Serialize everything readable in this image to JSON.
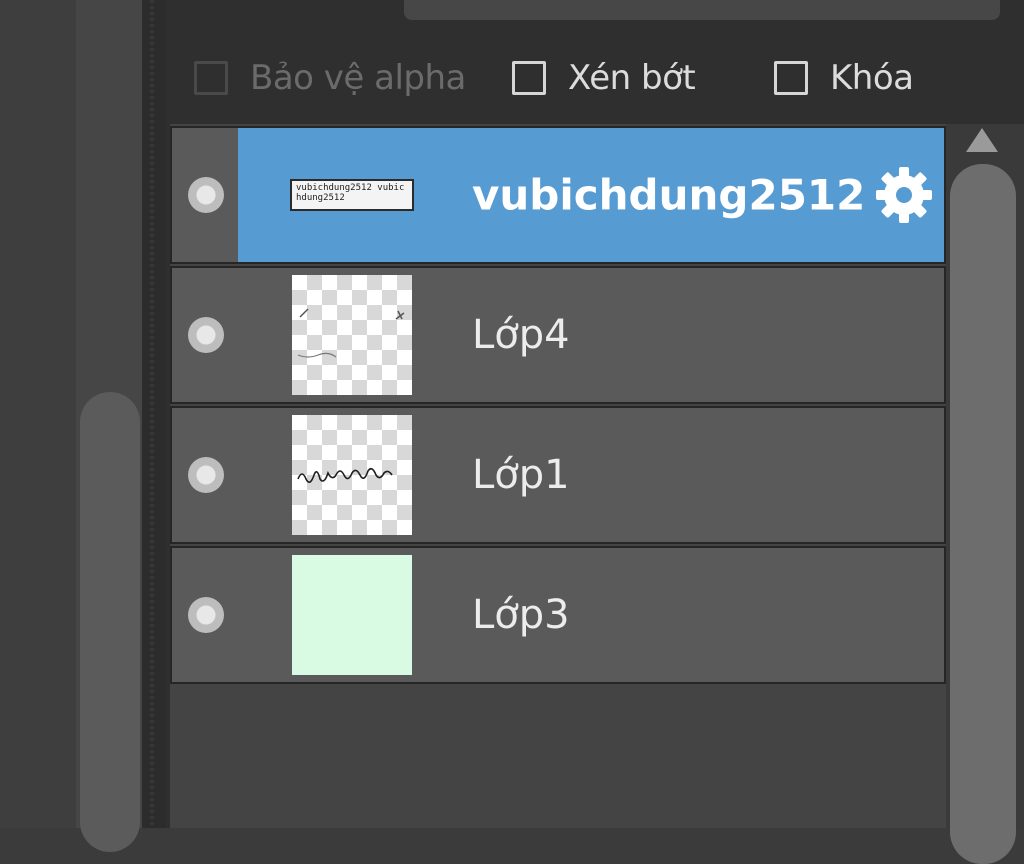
{
  "options": {
    "protect_alpha": {
      "label": "Bảo vệ alpha",
      "checked": false,
      "enabled": false
    },
    "clipping": {
      "label": "Xén bớt",
      "checked": false,
      "enabled": true
    },
    "lock": {
      "label": "Khóa",
      "checked": false,
      "enabled": true
    }
  },
  "layers": [
    {
      "name": "vubichdung2512",
      "selected": true,
      "visible": true,
      "thumb_type": "text",
      "thumb_text": "vubichdung2512 vubichdung2512"
    },
    {
      "name": "Lớp4",
      "selected": false,
      "visible": true,
      "thumb_type": "transparent"
    },
    {
      "name": "Lớp1",
      "selected": false,
      "visible": true,
      "thumb_type": "scribble"
    },
    {
      "name": "Lớp3",
      "selected": false,
      "visible": true,
      "thumb_type": "fill"
    }
  ],
  "colors": {
    "selection": "#579bd3",
    "row_bg": "#5a5a5a",
    "fill_layer": "#d9fbe3"
  }
}
